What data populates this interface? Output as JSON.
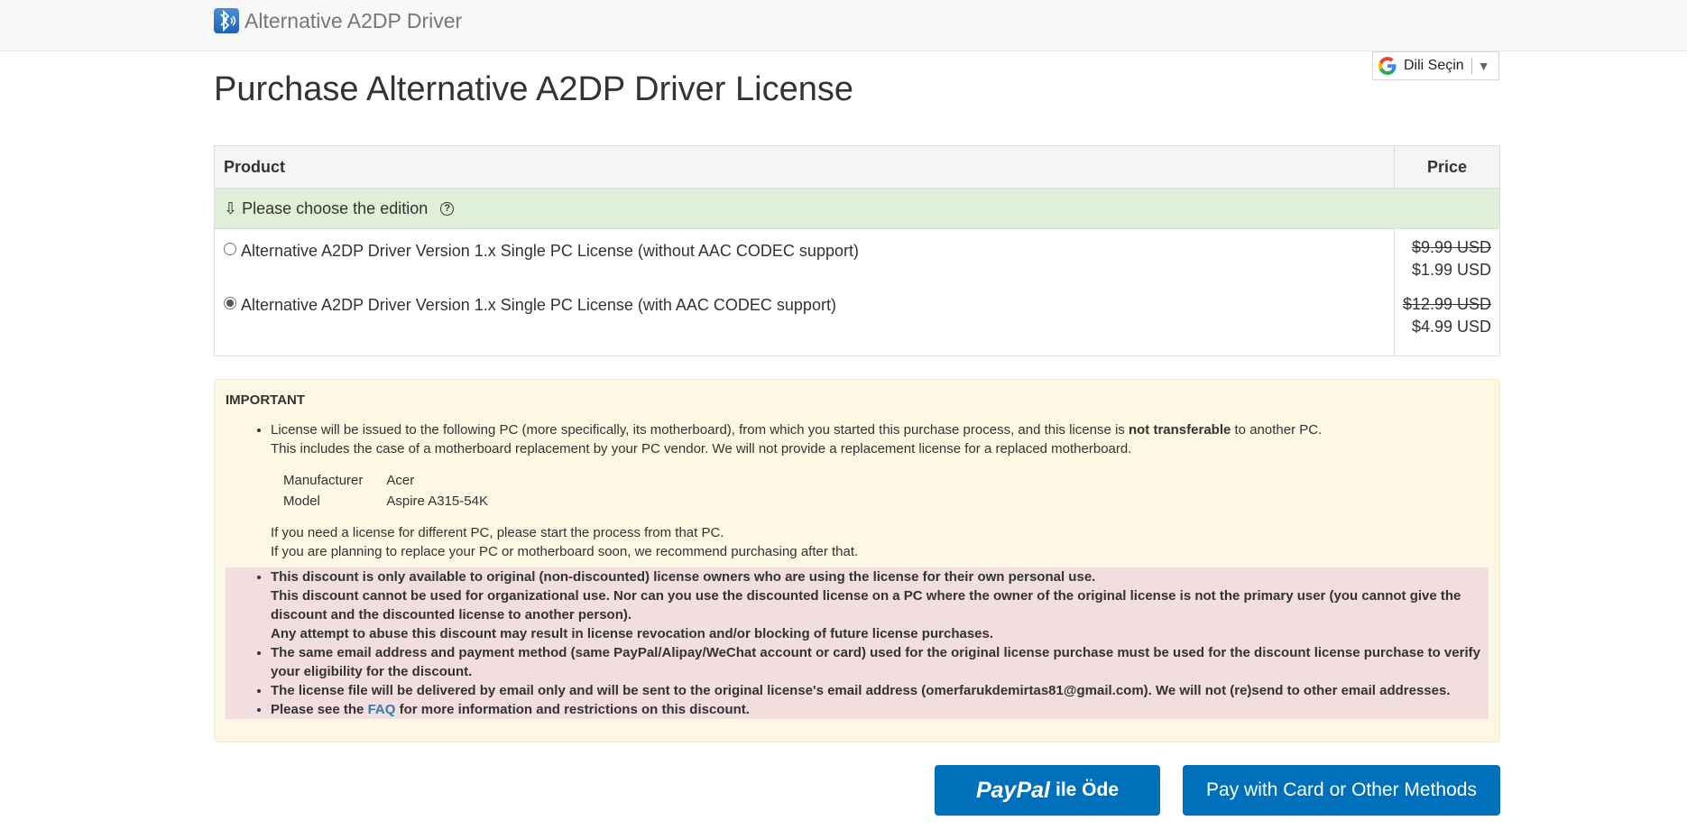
{
  "header": {
    "app_name": "Alternative A2DP Driver",
    "app_icon": "bluetooth-speaker-icon"
  },
  "language": {
    "label": "Dili Seçin",
    "arrow": "▼",
    "icon": "google-g-icon"
  },
  "page": {
    "title": "Purchase Alternative A2DP Driver License"
  },
  "table": {
    "col_product": "Product",
    "col_price": "Price",
    "choose_label": "⇩ Please choose the edition",
    "help_glyph": "?",
    "options": [
      {
        "label": "Alternative A2DP Driver Version 1.x Single PC License (without AAC CODEC support)",
        "old_price": "$9.99 USD",
        "new_price": "$1.99 USD",
        "selected": false
      },
      {
        "label": "Alternative A2DP Driver Version 1.x Single PC License (with AAC CODEC support)",
        "old_price": "$12.99 USD",
        "new_price": "$4.99 USD",
        "selected": true
      }
    ]
  },
  "notice": {
    "title": "IMPORTANT",
    "line1a": "License will be issued to the following PC (more specifically, its motherboard), from which you started this purchase process, and this license is ",
    "line1b": "not transferable",
    "line1c": " to another PC.",
    "line2": "This includes the case of a motherboard replacement by your PC vendor. We will not provide a replacement license for a replaced motherboard.",
    "pc": {
      "manufacturer_label": "Manufacturer",
      "manufacturer": "Acer",
      "model_label": "Model",
      "model": "Aspire A315-54K"
    },
    "line3": "If you need a license for different PC, please start the process from that PC.",
    "line4": "If you are planning to replace your PC or motherboard soon, we recommend purchasing after that."
  },
  "warnings": {
    "w1a": "This discount is only available to original (non-discounted) license owners who are using the license for their own personal use.",
    "w1b": "This discount cannot be used for organizational use. Nor can you use the discounted license on a PC where the owner of the original license is not the primary user (you cannot give the discount and the discounted license to another person).",
    "w1c": "Any attempt to abuse this discount may result in license revocation and/or blocking of future license purchases.",
    "w2": "The same email address and payment method (same PayPal/Alipay/WeChat account or card) used for the original license purchase must be used for the discount license purchase to verify your eligibility for the discount.",
    "w3": "The license file will be delivered by email only and will be sent to the original license's email address (omerfarukdemirtas81@gmail.com). We will not (re)send to other email addresses.",
    "w4a": "Please see the ",
    "w4_link": "FAQ",
    "w4b": " for more information and restrictions on this discount."
  },
  "buttons": {
    "paypal_logo": "PayPal",
    "paypal_text": "ile Öde",
    "card": "Pay with Card or Other Methods"
  },
  "colors": {
    "accent": "#0070ba",
    "success_bg": "#dff0d8",
    "warning_bg": "#fcf8e3",
    "danger_bg": "#f2dede"
  }
}
